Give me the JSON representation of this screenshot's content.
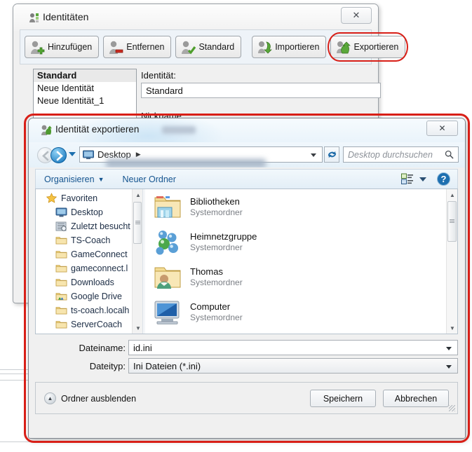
{
  "colors": {
    "highlight_ring": "#d81f17",
    "link_blue": "#14548f",
    "window_bg": "#f0f0f0",
    "dialog_title": "#eaf4fb"
  },
  "identities_window": {
    "title": "Identitäten",
    "title_icon": "user-identities-icon",
    "close_label": "✕",
    "toolbar": [
      {
        "label": "Hinzufügen",
        "icon": "user-add-icon",
        "highlighted": false
      },
      {
        "label": "Entfernen",
        "icon": "user-remove-icon",
        "highlighted": false
      },
      {
        "label": "Standard",
        "icon": "user-check-icon",
        "highlighted": false
      },
      {
        "label": "Importieren",
        "icon": "user-import-icon",
        "highlighted": false
      },
      {
        "label": "Exportieren",
        "icon": "user-export-icon",
        "highlighted": true
      }
    ],
    "identity_list": [
      {
        "label": "Standard",
        "selected": true
      },
      {
        "label": "Neue Identität",
        "selected": false
      },
      {
        "label": "Neue Identität_1",
        "selected": false
      }
    ],
    "fields": [
      {
        "label": "Identität:",
        "value": "Standard"
      },
      {
        "label": "Nickname:",
        "value": ""
      }
    ]
  },
  "save_dialog": {
    "title": "Identität exportieren",
    "title_icon": "export-identity-icon",
    "close_label": "✕",
    "nav": {
      "back_icon": "back-arrow-icon",
      "forward_icon": "forward-arrow-icon",
      "history_icon": "chevron-down-icon",
      "address_icon": "desktop-monitor-icon",
      "address_value": "Desktop",
      "address_separator": "▶",
      "address_caret_icon": "chevron-down-icon",
      "refresh_icon": "refresh-icon",
      "search_placeholder": "Desktop durchsuchen",
      "search_value": "",
      "search_icon": "magnifier-icon"
    },
    "command_bar": {
      "organize_label": "Organisieren",
      "organize_caret_icon": "chevron-down-icon",
      "new_folder_label": "Neuer Ordner",
      "view_icon": "view-layout-icon",
      "view_caret_icon": "chevron-down-icon",
      "help_icon": "help-question-icon"
    },
    "nav_pane": [
      {
        "label": "Favoriten",
        "icon": "star-icon",
        "level": 0
      },
      {
        "label": "Desktop",
        "icon": "desktop-icon",
        "level": 1
      },
      {
        "label": "Zuletzt besucht",
        "icon": "recent-places-icon",
        "level": 1
      },
      {
        "label": "TS-Coach",
        "icon": "folder-icon",
        "level": 1
      },
      {
        "label": "GameConnect",
        "icon": "folder-icon",
        "level": 1
      },
      {
        "label": "gameconnect.l",
        "icon": "folder-icon",
        "level": 1
      },
      {
        "label": "Downloads",
        "icon": "folder-icon",
        "level": 1
      },
      {
        "label": "Google Drive",
        "icon": "google-drive-folder-icon",
        "level": 1
      },
      {
        "label": "ts-coach.localh",
        "icon": "folder-icon",
        "level": 1
      },
      {
        "label": "ServerCoach",
        "icon": "folder-icon",
        "level": 1
      }
    ],
    "file_list": [
      {
        "name": "Bibliotheken",
        "type": "Systemordner",
        "icon": "libraries-icon"
      },
      {
        "name": "Heimnetzgruppe",
        "type": "Systemordner",
        "icon": "homegroup-icon"
      },
      {
        "name": "Thomas",
        "type": "Systemordner",
        "icon": "user-folder-icon"
      },
      {
        "name": "Computer",
        "type": "Systemordner",
        "icon": "computer-icon"
      }
    ],
    "filename": {
      "label": "Dateiname:",
      "value": "id.ini",
      "caret_icon": "chevron-down-icon"
    },
    "filetype": {
      "label": "Dateityp:",
      "value": "Ini Dateien (*.ini)",
      "caret_icon": "chevron-down-icon"
    },
    "footer": {
      "hide_folders_label": "Ordner ausblenden",
      "hide_folders_icon": "chevron-up-circle-icon",
      "save_label": "Speichern",
      "cancel_label": "Abbrechen",
      "resize_grip_icon": "resize-grip-icon"
    },
    "scrollbars": {
      "up_arrow_icon": "▲",
      "down_arrow_icon": "▼"
    }
  }
}
